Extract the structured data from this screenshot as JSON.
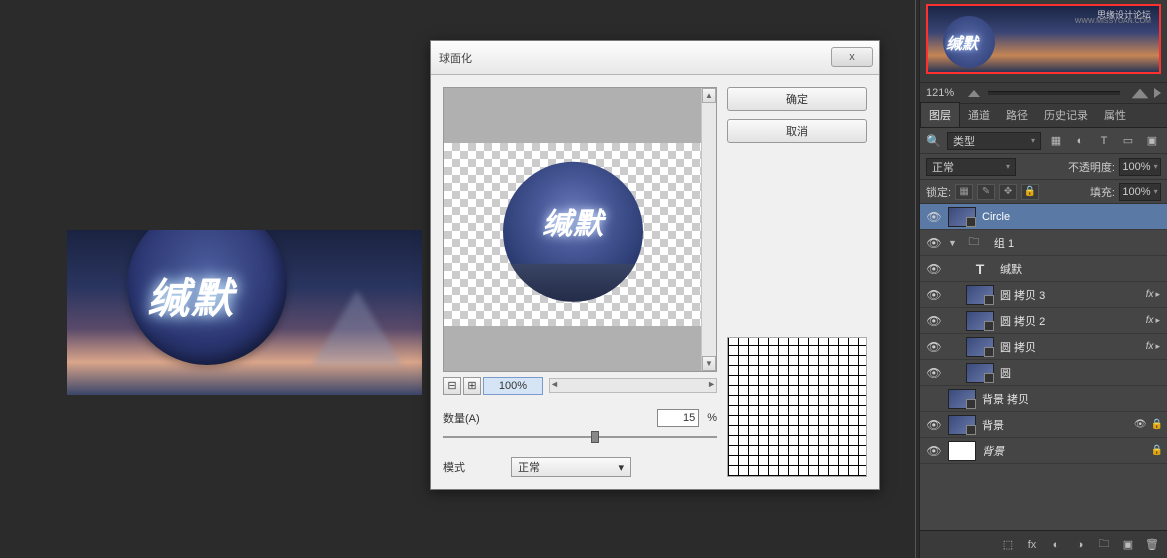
{
  "canvas": {
    "mainText": "缄默"
  },
  "dialog": {
    "title": "球面化",
    "close": "x",
    "ok": "确定",
    "cancel": "取消",
    "zoomMinus": "⊟",
    "zoomPlus": "⊞",
    "zoom": "100%",
    "amountLabel": "数量(A)",
    "amountValue": "15",
    "amountPct": "%",
    "modeLabel": "模式",
    "modeValue": "正常",
    "sphereText": "缄默"
  },
  "navigator": {
    "brand1": "思缘设计论坛",
    "brand2": "WWW.MISSYUAN.COM",
    "text": "缄默",
    "zoom": "121%"
  },
  "panelTabs": [
    "图层",
    "通道",
    "路径",
    "历史记录",
    "属性"
  ],
  "filter": {
    "label": "类型"
  },
  "blend": {
    "mode": "正常",
    "opacityLabel": "不透明度:",
    "opacity": "100%"
  },
  "lock": {
    "label": "锁定:",
    "fillLabel": "填充:",
    "fill": "100%"
  },
  "layers": [
    {
      "vis": true,
      "indent": 0,
      "kind": "smart",
      "name": "Circle",
      "sel": true
    },
    {
      "vis": true,
      "indent": 0,
      "kind": "folder",
      "name": "组 1",
      "arrow": "▼"
    },
    {
      "vis": true,
      "indent": 1,
      "kind": "type",
      "name": "缄默"
    },
    {
      "vis": true,
      "indent": 1,
      "kind": "smart",
      "name": "圆 拷贝 3",
      "fx": true
    },
    {
      "vis": true,
      "indent": 1,
      "kind": "smart",
      "name": "圆 拷贝 2",
      "fx": true
    },
    {
      "vis": true,
      "indent": 1,
      "kind": "smart",
      "name": "圆 拷贝",
      "fx": true
    },
    {
      "vis": true,
      "indent": 1,
      "kind": "smart",
      "name": "圆"
    },
    {
      "vis": false,
      "indent": 0,
      "kind": "smart",
      "name": "背景 拷贝"
    },
    {
      "vis": true,
      "indent": 0,
      "kind": "smart",
      "name": "背景",
      "link": true,
      "lock": true
    },
    {
      "vis": true,
      "indent": 0,
      "kind": "white",
      "name": "背景",
      "italic": true,
      "lock": true
    }
  ]
}
